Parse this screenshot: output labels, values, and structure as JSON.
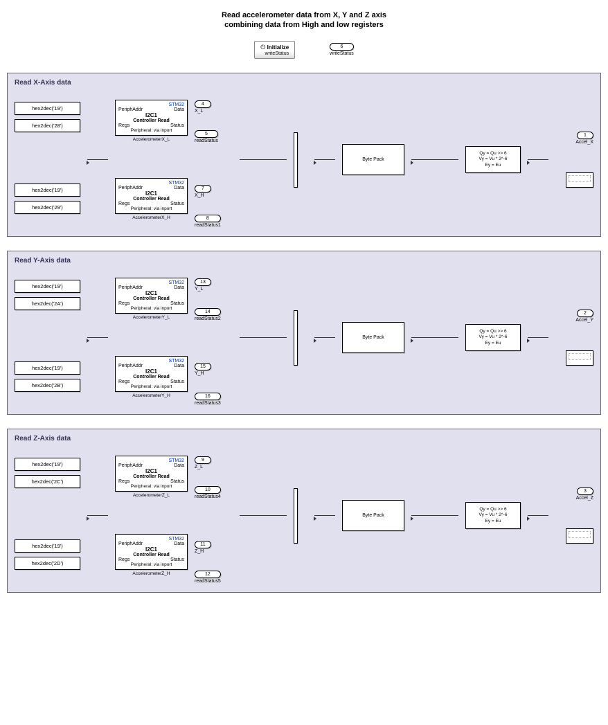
{
  "title_line1": "Read accelerometer data from X, Y and Z axis",
  "title_line2": "combining data from High and low registers",
  "init": {
    "icon_label": "Initialize",
    "sub_label": "writeStatus",
    "port_num": "6",
    "port_name": "writeStatus"
  },
  "sections": [
    {
      "title": "Read X-Axis data",
      "low": {
        "addr_const": "hex2dec('19')",
        "reg_const": "hex2dec('28')",
        "reader_name": "AccelerometerX_L",
        "data_port_num": "4",
        "data_port_name": "X_L",
        "status_port_num": "5",
        "status_port_name": "readStatus"
      },
      "high": {
        "addr_const": "hex2dec('19')",
        "reg_const": "hex2dec('29')",
        "reader_name": "AccelerometerX_H",
        "data_port_num": "7",
        "data_port_name": "X_H",
        "status_port_num": "8",
        "status_port_name": "readStatus1"
      },
      "out_port_num": "1",
      "out_port_name": "Accel_X"
    },
    {
      "title": "Read Y-Axis data",
      "low": {
        "addr_const": "hex2dec('19')",
        "reg_const": "hex2dec('2A')",
        "reader_name": "AccelerometerY_L",
        "data_port_num": "13",
        "data_port_name": "Y_L",
        "status_port_num": "14",
        "status_port_name": "readStatus2"
      },
      "high": {
        "addr_const": "hex2dec('19')",
        "reg_const": "hex2dec('2B')",
        "reader_name": "AccelerometerY_H",
        "data_port_num": "15",
        "data_port_name": "Y_H",
        "status_port_num": "16",
        "status_port_name": "readStatus3"
      },
      "out_port_num": "2",
      "out_port_name": "Accel_Y"
    },
    {
      "title": "Read Z-Axis data",
      "low": {
        "addr_const": "hex2dec('19')",
        "reg_const": "hex2dec('2C')",
        "reader_name": "AccelerometerZ_L",
        "data_port_num": "9",
        "data_port_name": "Z_L",
        "status_port_num": "10",
        "status_port_name": "readStatus4"
      },
      "high": {
        "addr_const": "hex2dec('19')",
        "reg_const": "hex2dec('2D')",
        "reader_name": "AccelerometerZ_H",
        "data_port_num": "11",
        "data_port_name": "Z_H",
        "status_port_num": "12",
        "status_port_name": "readStatus5"
      },
      "out_port_num": "3",
      "out_port_name": "Accel_Z"
    }
  ],
  "reader": {
    "vendor": "STM32",
    "port_periph": "PeriphAddr",
    "port_data": "Data",
    "bus": "I2C1",
    "title": "Controller Read",
    "port_regs": "Regs",
    "port_status": "Status",
    "periph_text": "Peripheral: via inport"
  },
  "pack_label": "Byte Pack",
  "shift_line1": "Qy = Qu >> 6",
  "shift_line2": "Vy = Vu * 2^-6",
  "shift_line3": "Ey = Eu"
}
